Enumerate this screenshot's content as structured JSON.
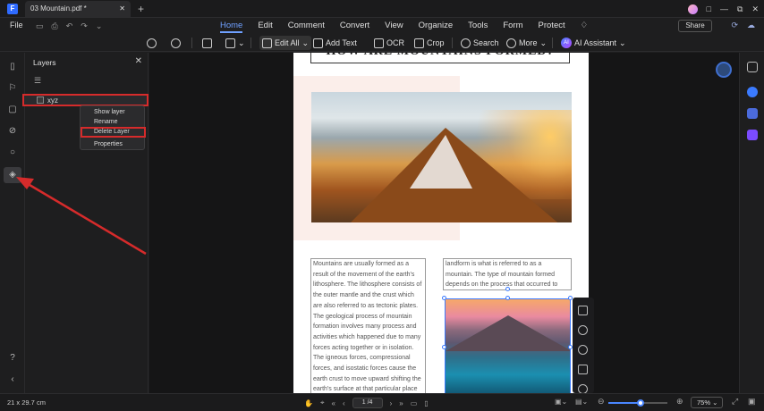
{
  "titlebar": {
    "logo": "F",
    "tab_title": "03 Mountain.pdf *",
    "tab_close": "✕",
    "tab_add": "+",
    "win_controls": [
      "□",
      "—",
      "⧉",
      "✕"
    ]
  },
  "menubar": {
    "file": "File",
    "menus": [
      "Home",
      "Edit",
      "Comment",
      "Convert",
      "View",
      "Organize",
      "Tools",
      "Form",
      "Protect"
    ],
    "active_menu": "Home",
    "share": "Share"
  },
  "toolbar": {
    "edit_all": "Edit All",
    "add_text": "Add Text",
    "ocr": "OCR",
    "crop": "Crop",
    "search": "Search",
    "more": "More",
    "ai_badge": "AI",
    "ai_assistant": "AI Assistant"
  },
  "layers_panel": {
    "title": "Layers",
    "close": "✕",
    "layer_name": "xyz"
  },
  "context_menu": {
    "items": [
      "Show layer",
      "Rename",
      "Delete Layer",
      "Properties"
    ],
    "highlighted": "Delete Layer"
  },
  "document": {
    "heading": "HOW ARE MOUNTAINS FORMED?",
    "left_text": "Mountains are usually formed as a result of the movement of the earth's lithosphere. The lithosphere consists of the outer mantle and the crust which are also referred to as tectonic plates. The geological process of mountain formation involves many process and activities which happened due to many forces acting together or in isolation. The igneous forces, compressional forces, and isostatic forces cause the earth crust to move upward shifting the earth's surface at that particular place to be higher than the surrounding environment. The resultant",
    "right_text": "landform is what is referred to as a mountain. The type of mountain formed depends on the process that occurred to form it."
  },
  "statusbar": {
    "page_size": "21 x 29.7 cm",
    "page_indicator": "1 /4",
    "zoom": "75%",
    "zoom_level": 0.55
  },
  "colors": {
    "accent": "#4a86ff",
    "highlight_red": "#d62b2b",
    "background": "#1e1e1f"
  }
}
